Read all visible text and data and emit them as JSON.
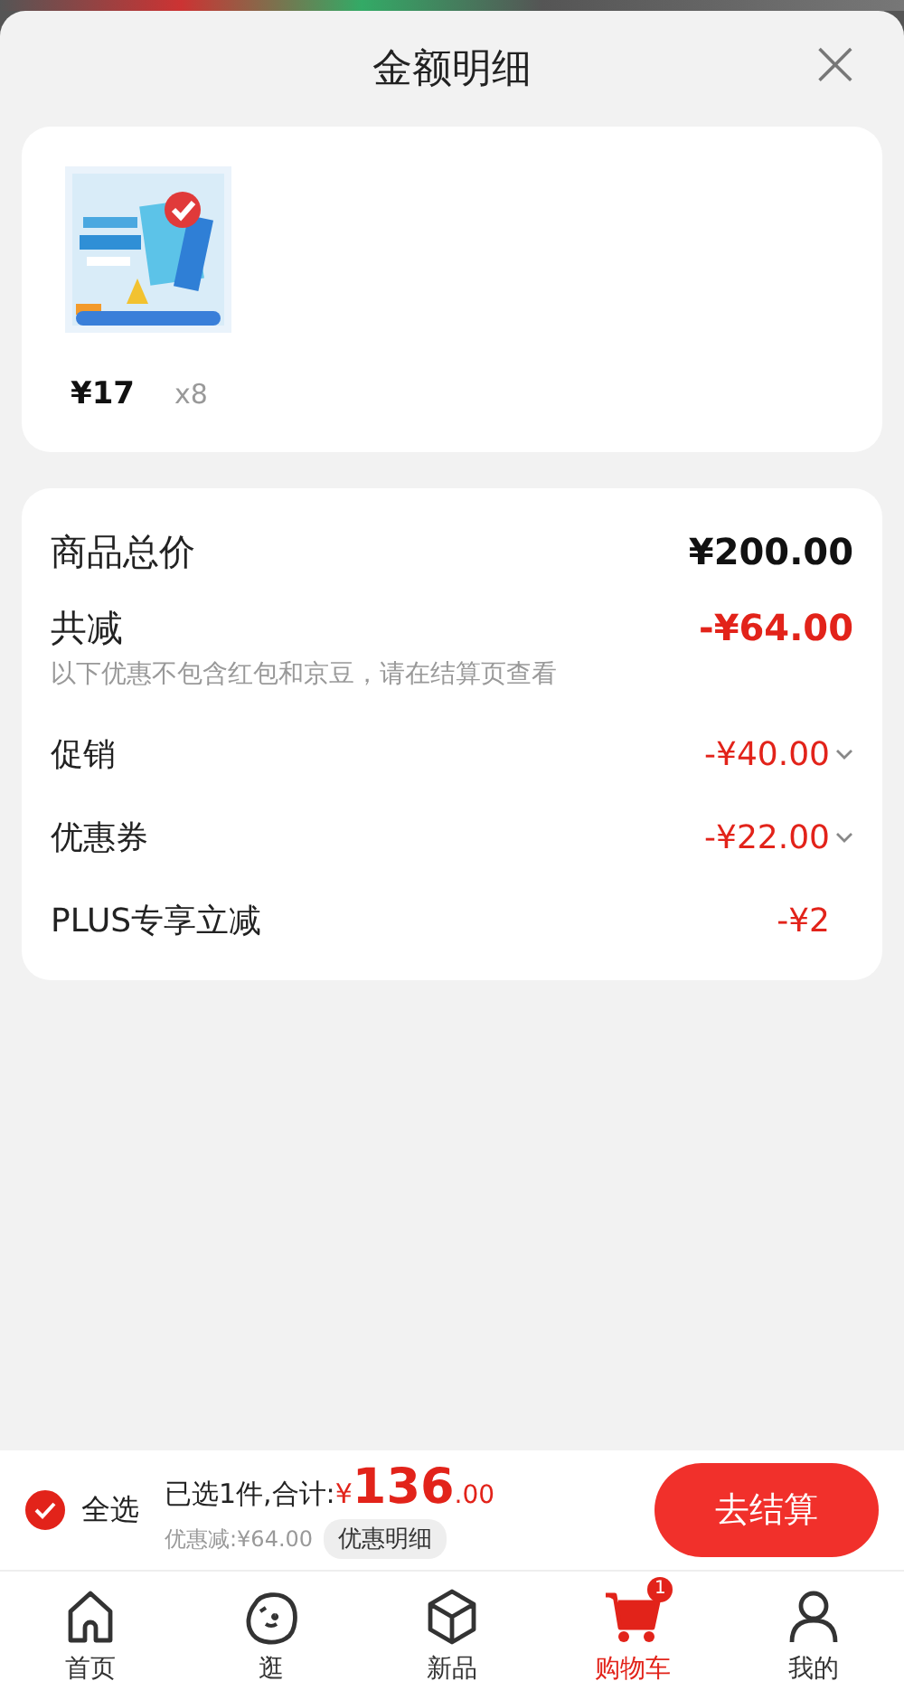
{
  "sheet": {
    "title": "金额明细",
    "close": "×"
  },
  "products": [
    {
      "kind": "picture",
      "price": "¥17",
      "quantity": "x8"
    }
  ],
  "summary": [
    {
      "kind": "total",
      "label": "商品总价",
      "amount": "¥200.00"
    },
    {
      "kind": "savings",
      "label": "共减",
      "amount": "-¥64.00",
      "note": "以下优惠不包含红包和京豆，请在结算页查看"
    },
    {
      "kind": "detail",
      "label": "促销",
      "amount": "-¥40.00",
      "expandable": true
    },
    {
      "kind": "detail",
      "label": "优惠券",
      "amount": "-¥22.00",
      "expandable": true
    },
    {
      "kind": "detail",
      "label": "PLUS专享立减",
      "amount": "-¥2",
      "expandable": false
    }
  ],
  "checkout": {
    "select_all": {
      "label": "全选",
      "checked": true
    },
    "selected_text": "已选1件,合计:",
    "currency": "¥",
    "total_int": "136",
    "total_dec": ".00",
    "discount_text": "优惠减:¥64.00",
    "details_button": "优惠明细",
    "pay_button": "去结算"
  },
  "tabs": [
    {
      "label": "首页",
      "kind": "home",
      "selected": false
    },
    {
      "label": "逛",
      "kind": "face",
      "selected": false
    },
    {
      "label": "新品",
      "kind": "box",
      "selected": false
    },
    {
      "label": "购物车",
      "kind": "cart",
      "selected": true,
      "badge": "1"
    },
    {
      "label": "我的",
      "kind": "person",
      "selected": false
    }
  ]
}
